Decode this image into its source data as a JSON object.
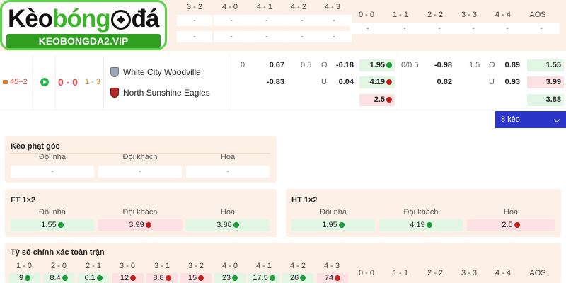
{
  "logo": {
    "title_a": "Kèo",
    "title_b": "bóng",
    "title_c": "đá",
    "site": "KEOBONGDA2.VIP"
  },
  "top_grid": {
    "headers_left": [
      "3 - 2",
      "4 - 0",
      "4 - 1",
      "4 - 2",
      "4 - 3"
    ],
    "row1_left": [
      "-",
      "-",
      "-",
      "-",
      "-"
    ],
    "row2_left": [
      "-",
      "-",
      "-",
      "-",
      "-"
    ],
    "headers_right": [
      "0 - 0",
      "1 - 1",
      "2 - 2",
      "3 - 3",
      "4 - 4",
      "AOS"
    ],
    "row1_right": [
      "-",
      "-",
      "-",
      "-",
      "-",
      "-"
    ]
  },
  "match": {
    "minute": "45+2",
    "score": "0 - 0",
    "ht_score": "1 - 3",
    "home_team": "White City Woodville",
    "away_team": "North Sunshine Eagles",
    "handicap": {
      "home_line": "0",
      "home_odd": "0.67",
      "away_odd": "-0.83"
    },
    "over_under": {
      "line": "0.5",
      "o_label": "O",
      "o_odd": "-0.18",
      "u_label": "U",
      "u_odd": "0.04"
    },
    "x12": {
      "home": "1.95",
      "away": "4.19",
      "draw": "2.5"
    },
    "ht_handicap": {
      "line": "0/0.5",
      "home_odd": "-0.98",
      "away_odd": "0.82"
    },
    "ht_over_under": {
      "line": "1.5",
      "o_label": "O",
      "o_odd": "0.89",
      "u_label": "U",
      "u_odd": "0.93"
    },
    "ht_x12": {
      "home": "1.55",
      "away": "3.99",
      "draw": "3.88"
    },
    "more_label": "8 kèo"
  },
  "corner_panel": {
    "title": "Kèo phạt góc",
    "cols": [
      "Đội nhà",
      "Đội khách",
      "Hòa"
    ],
    "vals": [
      "-",
      "-",
      "-"
    ]
  },
  "ft_panel": {
    "title": "FT 1×2",
    "cols": [
      "Đội nhà",
      "Đội khách",
      "Hòa"
    ],
    "vals": [
      "1.55",
      "3.99",
      "3.88"
    ]
  },
  "ht_panel": {
    "title": "HT 1×2",
    "cols": [
      "Đội nhà",
      "Đội khách",
      "Hòa"
    ],
    "vals": [
      "1.95",
      "4.19",
      "2.5"
    ]
  },
  "correct_score": {
    "title": "Tỷ số chính xác toàn trận",
    "headers": [
      "1 - 0",
      "2 - 0",
      "2 - 1",
      "3 - 0",
      "3 - 1",
      "3 - 2",
      "4 - 0",
      "4 - 1",
      "4 - 2",
      "4 - 3"
    ],
    "values": [
      "9",
      "8.4",
      "6.1",
      "12",
      "8.8",
      "15",
      "23",
      "17.5",
      "26",
      "74"
    ],
    "headers_right": [
      "0 - 0",
      "1 - 1",
      "2 - 2",
      "3 - 3",
      "4 - 4",
      "AOS"
    ]
  }
}
